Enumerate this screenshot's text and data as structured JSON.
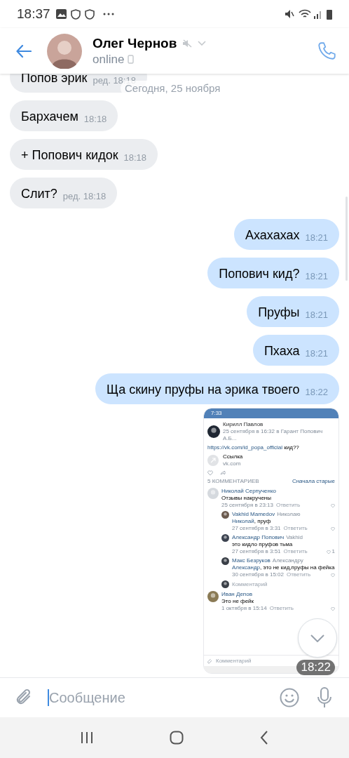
{
  "status_bar": {
    "time": "18:37"
  },
  "header": {
    "name": "Олег Чернов",
    "status": "online",
    "muted": true
  },
  "date_separator": "Сегодня, 25 ноября",
  "messages": [
    {
      "kind": "incoming",
      "text": "Попов эрик",
      "time": "ред. 18:18"
    },
    {
      "kind": "incoming",
      "text": "Бархачем",
      "time": "18:18"
    },
    {
      "kind": "incoming",
      "text": "+ Попович кидок",
      "time": "18:18"
    },
    {
      "kind": "incoming",
      "text": "Слит?",
      "time": "ред. 18:18"
    },
    {
      "kind": "outgoing",
      "text": "Ахахахах",
      "time": "18:21"
    },
    {
      "kind": "outgoing",
      "text": "Попович кид?",
      "time": "18:21"
    },
    {
      "kind": "outgoing",
      "text": "Пруфы",
      "time": "18:21"
    },
    {
      "kind": "outgoing",
      "text": "Пхаха",
      "time": "18:21"
    },
    {
      "kind": "outgoing",
      "text": "Ща скину пруфы на эрика твоего",
      "time": "18:22"
    },
    {
      "kind": "image",
      "time": "18:22",
      "screenshot": {
        "status_time": "7:33",
        "post": {
          "author": "Кирилл Павлов",
          "meta": "25 сентября в 16:32 в Гарант Попович А.Б...",
          "link": "https://vk.com/id_popa_official",
          "text": "кид??",
          "attachment_title": "Ссылка",
          "attachment_domain": "vk.com"
        },
        "comments_count": "5 КОММЕНТАРИЕВ",
        "sort": "Сначала старые",
        "comments": [
          {
            "author": "Николай Серпученко",
            "text": "Отзывы накручены",
            "date": "25 сентября в 23:13",
            "reply": "Ответить",
            "children": [
              {
                "author": "Vakhid Mamedov",
                "reply_to": "Николаю",
                "mention": "Николай",
                "text": ", пруф",
                "date": "27 сентября в 3:31",
                "reply": "Ответить"
              },
              {
                "author": "Александр Попович",
                "reply_to": "Vakhid",
                "text": "это кидло пруфов тьма",
                "date": "27 сентября в 3:51",
                "reply": "Ответить",
                "likes": "1"
              },
              {
                "author": "Макс Безруков",
                "reply_to": "Александру",
                "mention": "Александр",
                "text": ", это не кид,пруфы на фейка",
                "date": "30 сентября в 15:02",
                "reply": "Ответить"
              }
            ],
            "reply_field": "Комментарий"
          },
          {
            "author": "Иван Депов",
            "text": "Это не фейк",
            "date": "1 октября в 15:14",
            "reply": "Ответить"
          }
        ],
        "comment_field": "Комментарий"
      }
    }
  ],
  "composer": {
    "placeholder": "Сообщение"
  }
}
